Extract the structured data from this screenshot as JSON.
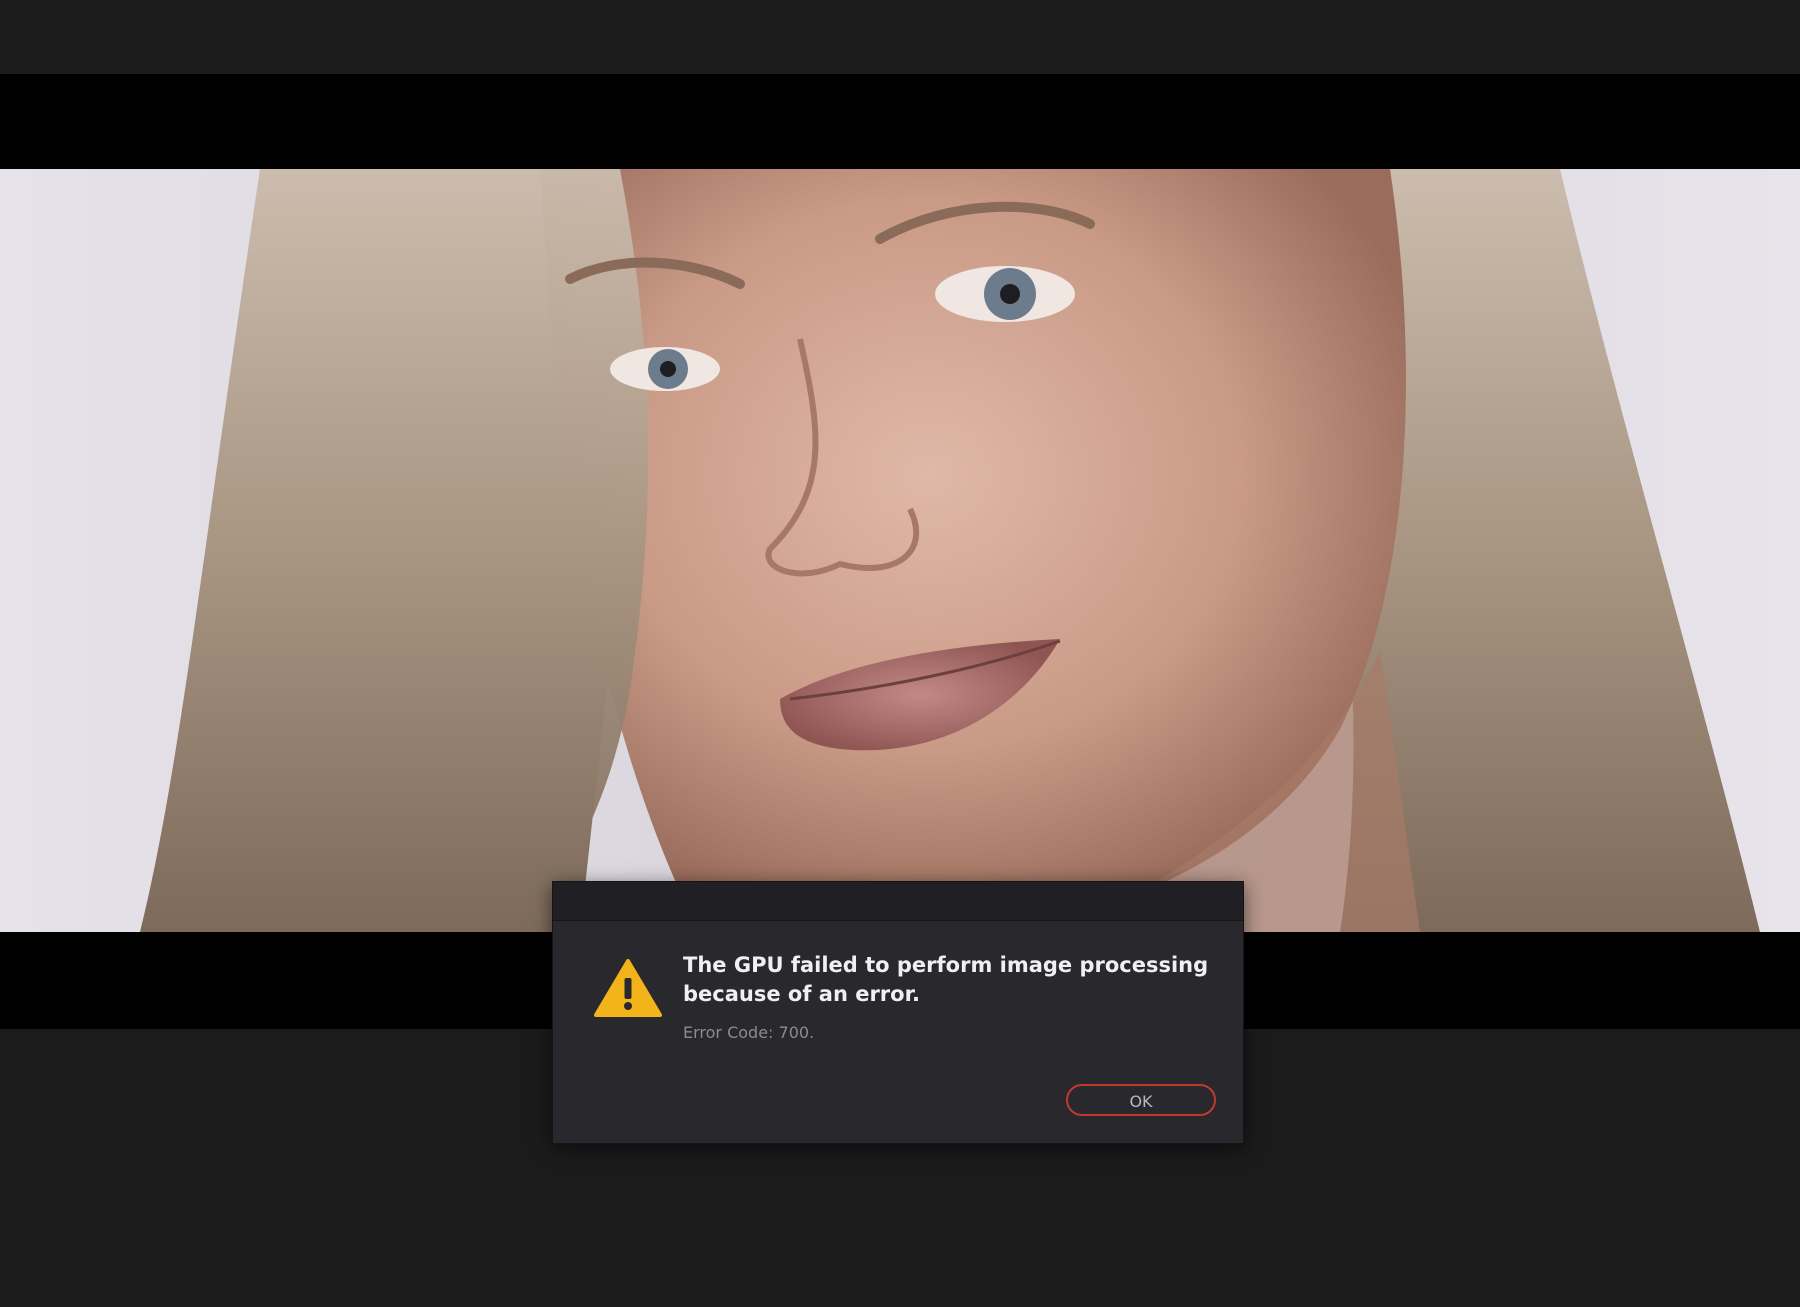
{
  "viewer": {
    "background_color": "#000000",
    "frame_description_icon": "portrait-video-frame"
  },
  "dialog": {
    "icon": "warning-icon",
    "icon_color": "#f2b31b",
    "message_line1": "The GPU failed to perform image processing",
    "message_line2": "because of an error.",
    "error_code": "Error Code: 700.",
    "ok_label": "OK",
    "accent_color": "#c23a2e"
  }
}
